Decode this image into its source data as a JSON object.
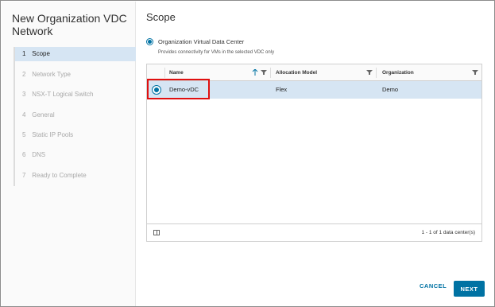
{
  "wizard": {
    "title": "New Organization VDC Network",
    "steps": [
      {
        "num": "1",
        "label": "Scope"
      },
      {
        "num": "2",
        "label": "Network Type"
      },
      {
        "num": "3",
        "label": "NSX-T Logical Switch"
      },
      {
        "num": "4",
        "label": "General"
      },
      {
        "num": "5",
        "label": "Static IP Pools"
      },
      {
        "num": "6",
        "label": "DNS"
      },
      {
        "num": "7",
        "label": "Ready to Complete"
      }
    ]
  },
  "main": {
    "title": "Scope",
    "option_label": "Organization Virtual Data Center",
    "option_desc": "Provides connectivity for VMs in the selected VDC only",
    "grid": {
      "columns": [
        "Name",
        "Allocation Model",
        "Organization"
      ],
      "rows": [
        {
          "name": "Demo-vDC",
          "allocation": "Flex",
          "organization": "Demo"
        }
      ],
      "footer": "1 - 1 of 1 data center(s)"
    },
    "buttons": {
      "cancel": "CANCEL",
      "next": "NEXT"
    }
  },
  "colors": {
    "accent": "#0072a3",
    "selected_row": "#d6e5f3",
    "highlight": "#e01010"
  }
}
